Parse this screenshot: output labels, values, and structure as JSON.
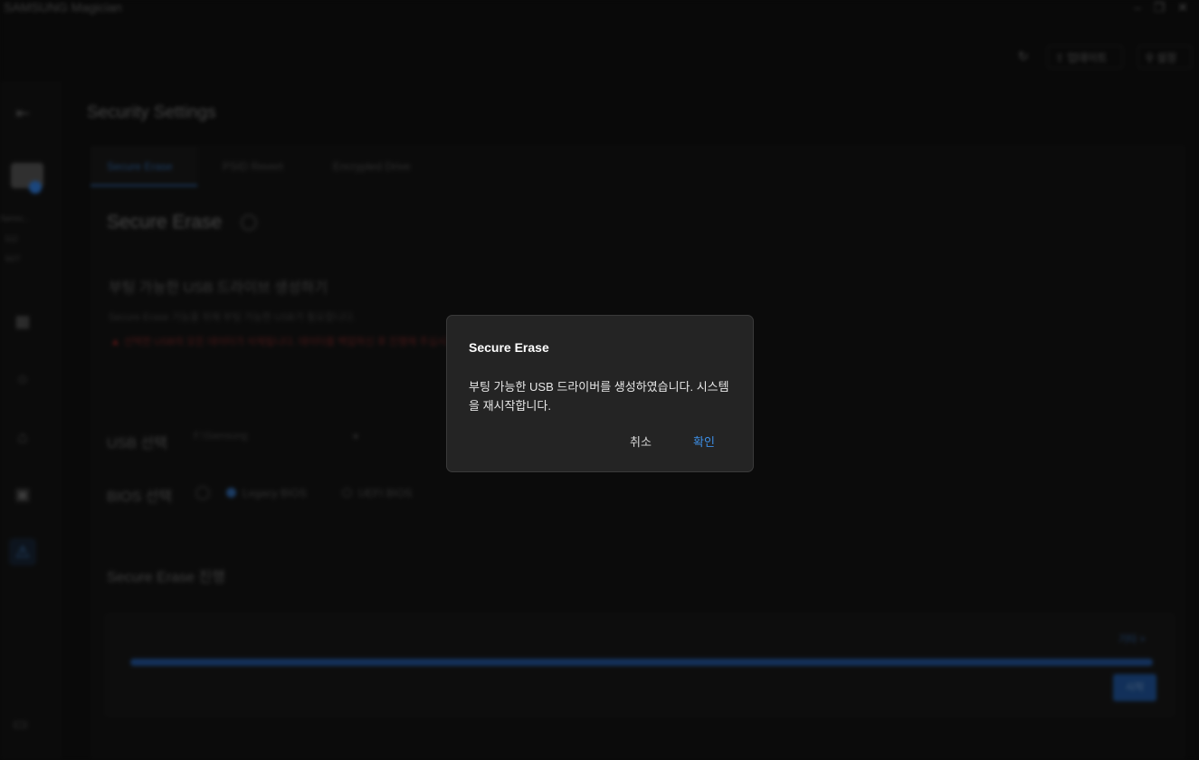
{
  "app": {
    "title": "SAMSUNG Magician",
    "header": {
      "update_label": "업데이트",
      "settings_label": "설정"
    }
  },
  "sidebar": {
    "drive_name": "Samsu...",
    "drive_info_1": "512",
    "drive_info_2": "NVT"
  },
  "page": {
    "title": "Security Settings",
    "tabs": [
      {
        "label": "Secure Erase",
        "active": true
      },
      {
        "label": "PSID Revert",
        "active": false
      },
      {
        "label": "Encrypted Drive",
        "active": false
      }
    ],
    "section_title": "Secure Erase",
    "usb_section": {
      "title": "부팅 가능한 USB 드라이브 생성하기",
      "description": "Secure Erase 기능을 위해 부팅 가능한 USB가 필요합니다.",
      "warning": "선택한 USB의 모든 데이터가 삭제됩니다. 데이터를 백업하신 후 진행해 주십시오."
    },
    "usb_select": {
      "label": "USB 선택",
      "value": "F:\\Samsung"
    },
    "bios_select": {
      "label": "BIOS 선택",
      "options": [
        {
          "label": "Legacy BIOS",
          "selected": true
        },
        {
          "label": "UEFI BIOS",
          "selected": false
        }
      ]
    },
    "progress_section": {
      "title": "Secure Erase 진행",
      "link_label": "기타 >",
      "progress_percent": 100,
      "button_label": "시작"
    }
  },
  "dialog": {
    "title": "Secure Erase",
    "message": "부팅 가능한 USB 드라이버를 생성하였습니다. 시스템을 재시작합니다.",
    "cancel_label": "취소",
    "ok_label": "확인"
  },
  "colors": {
    "dialog_bg": "#242424",
    "accent": "#3d8fe6",
    "warning": "#8a2020"
  }
}
